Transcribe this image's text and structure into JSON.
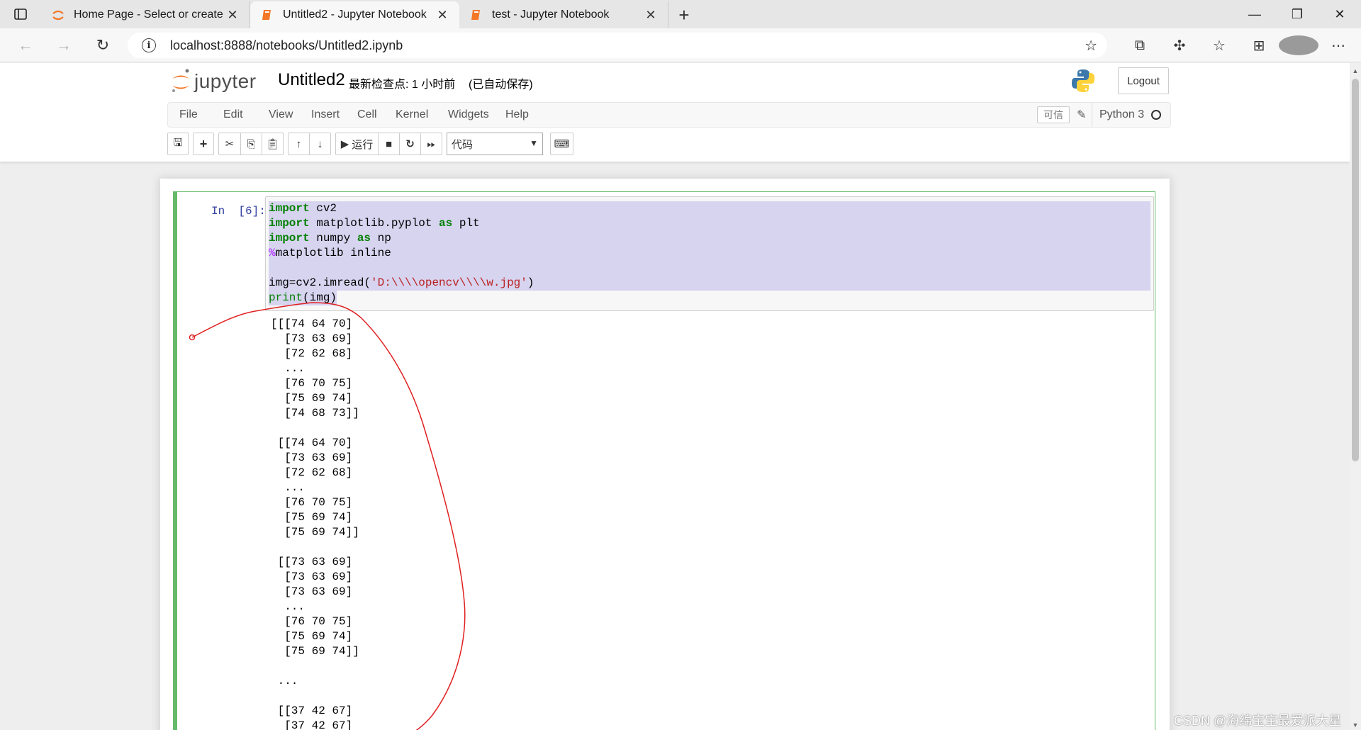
{
  "browser": {
    "tabs": [
      {
        "title": "Home Page - Select or create a n",
        "active": false
      },
      {
        "title": "Untitled2 - Jupyter Notebook",
        "active": true
      },
      {
        "title": "test - Jupyter Notebook",
        "active": false
      }
    ],
    "url": "localhost:8888/notebooks/Untitled2.ipynb"
  },
  "header": {
    "logo_text": "jupyter",
    "notebook_name": "Untitled2",
    "checkpoint": "最新检查点: 1 小时前",
    "autosave": "(已自动保存)",
    "logout_label": "Logout"
  },
  "menubar": {
    "items": [
      "File",
      "Edit",
      "View",
      "Insert",
      "Cell",
      "Kernel",
      "Widgets",
      "Help"
    ],
    "trusted": "可信",
    "kernel_name": "Python 3"
  },
  "toolbar": {
    "run_label": "运行",
    "cell_type": "代码"
  },
  "cell": {
    "prompt": "In  [6]:",
    "code_lines": [
      "import cv2",
      "import matplotlib.pyplot as plt",
      "import numpy as np",
      "%matplotlib inline",
      "",
      "img=cv2.imread('D:\\\\opencv\\\\w.jpg')",
      "print(img)"
    ],
    "output": "[[[74 64 70]\n  [73 63 69]\n  [72 62 68]\n  ...\n  [76 70 75]\n  [75 69 74]\n  [74 68 73]]\n\n [[74 64 70]\n  [73 63 69]\n  [72 62 68]\n  ...\n  [76 70 75]\n  [75 69 74]\n  [75 69 74]]\n\n [[73 63 69]\n  [73 63 69]\n  [73 63 69]\n  ...\n  [76 70 75]\n  [75 69 74]\n  [75 69 74]]\n\n ...\n\n [[37 42 67]\n  [37 42 67]"
  },
  "colors": {
    "cell_border": "#66bb6a",
    "selection": "#d7d4f0",
    "keyword": "#008000",
    "string": "#ba2121",
    "magic": "#aa22ff",
    "annotation": "#e02020"
  },
  "watermark": "CSDN @海绵宝宝最爱派大星"
}
